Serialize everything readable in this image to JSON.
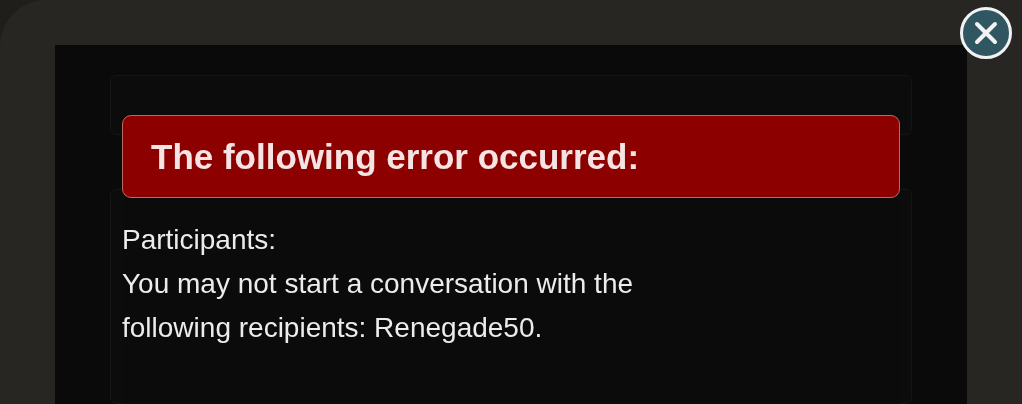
{
  "error": {
    "title": "The following error occurred:",
    "lines": [
      "Participants:",
      "You may not start a conversation with the",
      "following recipients: Renegade50."
    ]
  }
}
